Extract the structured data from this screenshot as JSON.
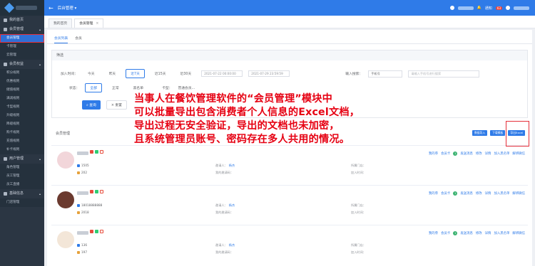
{
  "sidebar": {
    "items": [
      {
        "label": "我的首页"
      },
      {
        "label": "会员管理",
        "expanded": true,
        "children": [
          "会员管理",
          "卡管理",
          "云管理"
        ]
      },
      {
        "label": "会员权益",
        "expanded": true,
        "children": [
          "积分规则",
          "优惠规则",
          "储值规则",
          "满减规则",
          "卡型规则",
          "升级规则",
          "降级规则",
          "购卡规则",
          "充值规则",
          "补卡规则"
        ]
      },
      {
        "label": "用户管理",
        "expanded": true,
        "children": [
          "角色管理",
          "员工管理",
          "员工直播"
        ]
      },
      {
        "label": "基础信息",
        "expanded": true,
        "children": [
          "门店管理"
        ]
      }
    ]
  },
  "topbar": {
    "back_icon": "←",
    "system_name": "后台管理 ▾",
    "notice_label": "通知",
    "badge": "63"
  },
  "tabs": [
    {
      "label": "我的首页"
    },
    {
      "label": "会员管理",
      "active": true
    }
  ],
  "subtabs": [
    {
      "label": "会员列表",
      "active": true
    },
    {
      "label": "会员"
    }
  ],
  "filter": {
    "title": "筛选",
    "join_time_label": "加入时间：",
    "time_options": [
      "今天",
      "昨天",
      "近7天",
      "近15天",
      "近30天"
    ],
    "date_start": "2021-07-22 00:00:00",
    "date_end": "2021-07-29 23:59:59",
    "search_label": "输入搜索：",
    "search_select": "手机号",
    "search_placeholder": "请输入手机号进行搜索",
    "status_label": "状态：",
    "status_options": [
      "全部",
      "正常",
      "黑名单"
    ],
    "card_label": "卡型：",
    "card_value": "普通会员...",
    "query_button": "查询",
    "reset_button": "重置"
  },
  "list": {
    "title": "会员管理",
    "actions": [
      "数据导入",
      "下载模板",
      "导出Excel"
    ]
  },
  "members": [
    {
      "phone": "1505",
      "code": "202",
      "referrer_label": "邀请人：",
      "referrer": "杨杰",
      "invite_label": "我的邀请码：",
      "store_label": "所属门店：",
      "join_label": "加入时间：",
      "count": "1"
    },
    {
      "phone": "18018888888",
      "code": "2018",
      "referrer_label": "邀请人：",
      "referrer": "杨杰",
      "invite_label": "我的邀请码：",
      "store_label": "所属门店：",
      "join_label": "加入时间：",
      "count": "1"
    },
    {
      "phone": "136",
      "code": "197",
      "referrer_label": "邀请人：",
      "referrer": "杨杰",
      "invite_label": "我的邀请码：",
      "store_label": "所属门店：",
      "join_label": "加入时间：",
      "count": "1"
    }
  ],
  "member_ops": [
    "我的券",
    "会员卡",
    "发送消息",
    "修改",
    "详情",
    "加入黑名单",
    "解绑微信"
  ],
  "overlay": [
    "当事人在餐饮管理软件的“会员管理”模块中",
    "可以批量导出包含消费者个人信息的Excel文档，",
    "导出过程无安全验证，导出的文档也未加密，",
    "且系统管理员账号、密码存在多人共用的情况。"
  ]
}
